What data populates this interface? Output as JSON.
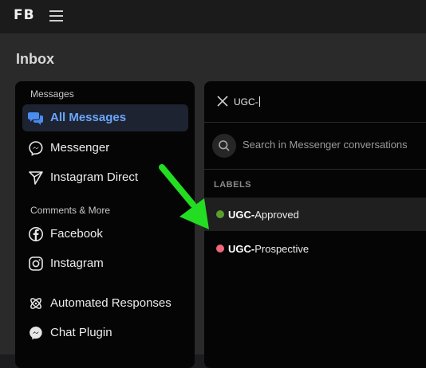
{
  "header": {
    "logo": "FB",
    "menu_icon": "hamburger-icon"
  },
  "page": {
    "title": "Inbox"
  },
  "sidebar": {
    "sections": [
      {
        "label": "Messages",
        "items": [
          {
            "label": "All Messages",
            "icon": "chat-bubbles-icon",
            "active": true
          },
          {
            "label": "Messenger",
            "icon": "messenger-icon"
          },
          {
            "label": "Instagram Direct",
            "icon": "paper-plane-icon"
          }
        ]
      },
      {
        "label": "Comments & More",
        "items": [
          {
            "label": "Facebook",
            "icon": "facebook-icon"
          },
          {
            "label": "Instagram",
            "icon": "instagram-icon"
          },
          {
            "label": "Automated Responses",
            "icon": "automation-icon"
          },
          {
            "label": "Chat Plugin",
            "icon": "messenger-icon"
          }
        ]
      }
    ]
  },
  "panel": {
    "query": "UGC-",
    "search_placeholder": "Search in Messenger conversations",
    "labels_header": "LABELS",
    "labels": [
      {
        "match": "UGC-",
        "rest": "Approved",
        "color": "#5a9e2f"
      },
      {
        "match": "UGC-",
        "rest": "Prospective",
        "color": "#f0677c"
      }
    ]
  },
  "colors": {
    "accent": "#6aa6ff",
    "arrow": "#22dd22"
  }
}
